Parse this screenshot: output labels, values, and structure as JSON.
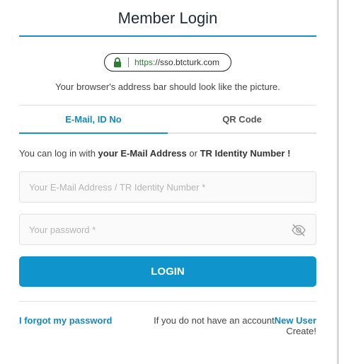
{
  "header": {
    "title": "Member Login"
  },
  "address_bar": {
    "https": "https:",
    "host": "//sso.btcturk.com"
  },
  "hint": "Your browser's address bar should look like the picture.",
  "tabs": [
    {
      "label": "E-Mail, ID No",
      "active": true
    },
    {
      "label": "QR Code",
      "active": false
    }
  ],
  "login_info": {
    "prefix": "You can log in with ",
    "email": "your E-Mail Address",
    "or": " or ",
    "tr_id": "TR Identity Number !"
  },
  "form": {
    "identity_placeholder": "Your E-Mail Address / TR Identity Number *",
    "identity_value": "",
    "password_placeholder": "Your password *",
    "password_value": "",
    "login_label": "LOGIN"
  },
  "footer": {
    "forgot_label": "I forgot my password",
    "no_account_text": "If you do not have an account",
    "new_user_label": "New User",
    "create_text": "Create!"
  },
  "colors": {
    "accent": "#0f95cb",
    "link": "#1787b8",
    "lock": "#2e7d32"
  },
  "icons": {
    "lock": "lock-icon",
    "password_toggle": "eye-slash-icon"
  }
}
